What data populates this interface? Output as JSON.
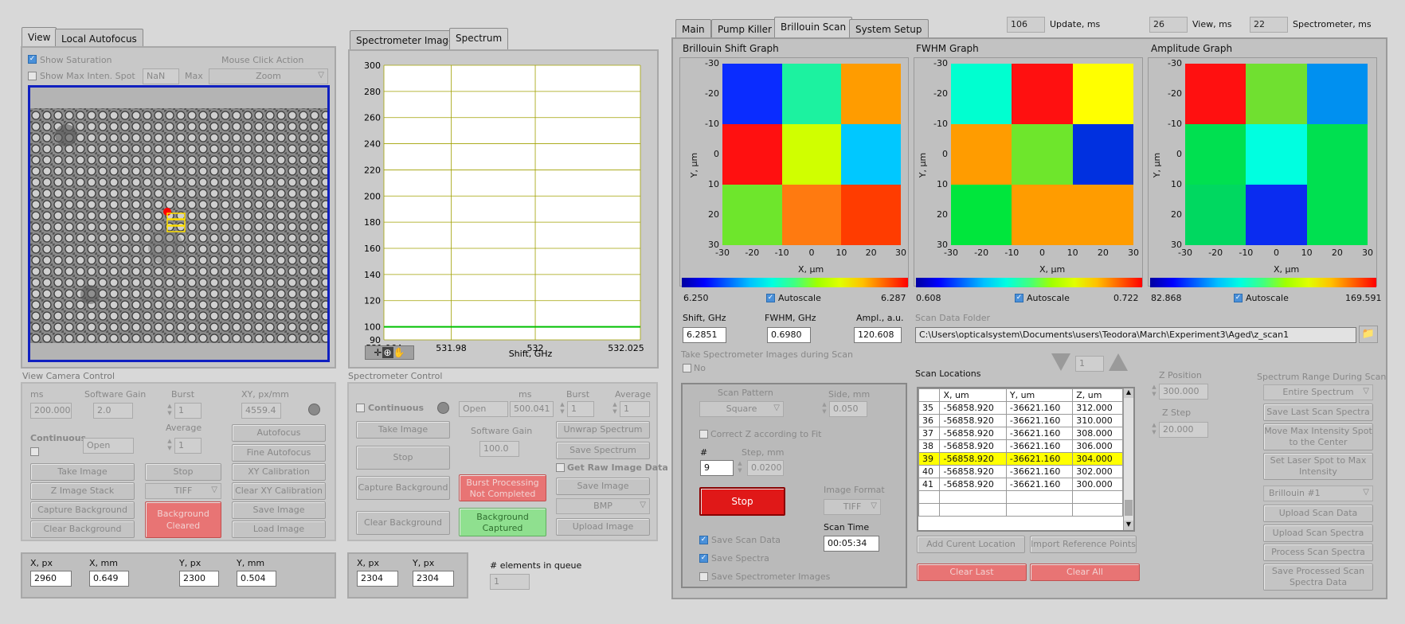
{
  "left": {
    "tabs": [
      "View",
      "Local Autofocus"
    ],
    "show_saturation": "Show Saturation",
    "show_max": "Show Max Inten. Spot",
    "max_value": "NaN",
    "max_label": "Max",
    "mouse_click_action": "Mouse Click Action",
    "zoom": "Zoom",
    "camera_control": "View Camera Control",
    "ms_label": "ms",
    "ms_value": "200.000",
    "gain_label": "Software Gain",
    "gain_value": "2.0",
    "burst_label": "Burst",
    "burst_value": "1",
    "xy_label": "XY, px/mm",
    "xy_value": "4559.4",
    "continuous": "Continuous",
    "open": "Open",
    "average_label": "Average",
    "average_value": "1",
    "buttons": {
      "autofocus": "Autofocus",
      "fine_autofocus": "Fine Autofocus",
      "take_image": "Take Image",
      "stop": "Stop",
      "xy_calibration": "XY Calibration",
      "z_stack": "Z Image Stack",
      "tiff": "TIFF",
      "clear_xy": "Clear XY Calibration",
      "capture_bg": "Capture Background",
      "bg_cleared": "Background Cleared",
      "save_image": "Save Image",
      "clear_bg": "Clear Background",
      "load_image": "Load Image"
    },
    "coords": {
      "xpx_label": "X, px",
      "xpx": "2960",
      "xmm_label": "X, mm",
      "xmm": "0.649",
      "ypx_label": "Y, px",
      "ypx": "2300",
      "ymm_label": "Y, mm",
      "ymm": "0.504"
    }
  },
  "spectro": {
    "tabs": [
      "Spectrometer Image",
      "Spectrum"
    ],
    "chart_data": {
      "type": "line",
      "x_ticks": [
        "531.964",
        "531.98",
        "532",
        "532.025"
      ],
      "y_ticks": [
        90,
        100,
        120,
        140,
        160,
        180,
        200,
        220,
        240,
        260,
        280,
        300
      ],
      "ylim": [
        90,
        300
      ],
      "xlim": [
        531.964,
        532.025
      ],
      "xlabel": "Shift, GHz",
      "series": [
        {
          "x": [
            531.964,
            532.025
          ],
          "y": [
            100,
            100
          ],
          "color": "#00c000"
        }
      ]
    },
    "control": "Spectrometer Control",
    "continuous": "Continuous",
    "ms_label": "ms",
    "open": "Open",
    "ms_value": "500.041",
    "burst_label": "Burst",
    "burst_value": "1",
    "average_label": "Average",
    "average_value": "1",
    "gain_label": "Software Gain",
    "gain_value": "100.0",
    "get_raw": "Get Raw Image Data",
    "buttons": {
      "take_image": "Take Image",
      "unwrap": "Unwrap Spectrum",
      "stop": "Stop",
      "save_spectrum": "Save Spectrum",
      "capture_bg": "Capture Background",
      "burst_processing": "Burst Processing Not Completed",
      "save_image": "Save Image",
      "clear_bg": "Clear Background",
      "bg_captured": "Background Captured",
      "bmp": "BMP",
      "upload_image": "Upload Image"
    },
    "coords": {
      "xpx_label": "X, px",
      "xpx": "2304",
      "ypx_label": "Y, px",
      "ypx": "2304"
    },
    "queue_label": "# elements in queue",
    "queue_value": "1"
  },
  "right": {
    "tabs": [
      "Main",
      "Pump Killer",
      "Brillouin Scan",
      "System Setup"
    ],
    "update_value": "106",
    "update_label": "Update, ms",
    "view_value": "26",
    "view_label": "View, ms",
    "spec_value": "22",
    "spec_label": "Spectrometer, ms",
    "graphs": [
      {
        "title": "Brillouin Shift Graph",
        "cells": [
          "#0a2cff",
          "#1cf2a0",
          "#ff9c00",
          "#ff1010",
          "#d0ff00",
          "#00c8ff",
          "#6ee62c",
          "#ff7a10",
          "#ff3c00"
        ],
        "min": "6.250",
        "max": "6.287"
      },
      {
        "title": "FWHM Graph",
        "cells": [
          "#00ffd0",
          "#ff1010",
          "#ffff00",
          "#ff9c00",
          "#6ee62c",
          "#0030e0",
          "#00e63c",
          "#ff9c00",
          "#ff9c00"
        ],
        "min": "0.608",
        "max": "0.722"
      },
      {
        "title": "Amplitude Graph",
        "cells": [
          "#ff1010",
          "#70e030",
          "#0090f0",
          "#00e050",
          "#00ffe0",
          "#00e050",
          "#00d860",
          "#0a2cf0",
          "#00e050"
        ],
        "min": "82.868",
        "max": "169.591"
      }
    ],
    "x_ticks": [
      "-30",
      "-20",
      "-10",
      "0",
      "10",
      "20",
      "30"
    ],
    "y_ticks": [
      "-30",
      "-20",
      "-10",
      "0",
      "10",
      "20",
      "30"
    ],
    "xlabel": "X, µm",
    "ylabel": "Y, µm",
    "autoscale": "Autoscale",
    "shift_label": "Shift, GHz",
    "shift_value": "6.2851",
    "fwhm_label": "FWHM, GHz",
    "fwhm_value": "0.6980",
    "ampl_label": "Ampl., a.u.",
    "ampl_value": "120.608",
    "folder_label": "Scan Data Folder",
    "folder_value": "C:\\Users\\opticalsystem\\Documents\\users\\Teodora\\March\\Experiment3\\Aged\\z_scan1",
    "take_spectro": "Take Spectrometer Images during Scan",
    "no": "No",
    "scan_pattern_label": "Scan Pattern",
    "scan_pattern": "Square",
    "side_label": "Side, mm",
    "side_value": "0.050",
    "correct_z": "Correct Z according to Fit",
    "num_label": "#",
    "num_value": "9",
    "step_label": "Step, mm",
    "step_value": "0.0200",
    "stop": "Stop",
    "image_format_label": "Image Format",
    "image_format": "TIFF",
    "scan_time_label": "Scan Time",
    "scan_time": "00:05:34",
    "save_scan_data": "Save Scan Data",
    "save_spectra": "Save Spectra",
    "save_spectro_images": "Save Spectrometer Images",
    "locations_label": "Scan Locations",
    "loc_headers": [
      "",
      "X, um",
      "Y, um",
      "Z, um"
    ],
    "loc_rows": [
      [
        "35",
        "-56858.920",
        "-36621.160",
        "312.000"
      ],
      [
        "36",
        "-56858.920",
        "-36621.160",
        "310.000"
      ],
      [
        "37",
        "-56858.920",
        "-36621.160",
        "308.000"
      ],
      [
        "38",
        "-56858.920",
        "-36621.160",
        "306.000"
      ],
      [
        "39",
        "-56858.920",
        "-36621.160",
        "304.000"
      ],
      [
        "40",
        "-56858.920",
        "-36621.160",
        "302.000"
      ],
      [
        "41",
        "-56858.920",
        "-36621.160",
        "300.000"
      ]
    ],
    "highlight_row": 4,
    "nav_value": "1",
    "add_location": "Add Curent Location",
    "import_ref": "Import Reference Points",
    "clear_last": "Clear Last",
    "clear_all": "Clear All",
    "zpos_label": "Z Position",
    "zpos_value": "300.000",
    "zstep_label": "Z Step",
    "zstep_value": "20.000",
    "spec_range_label": "Spectrum Range During Scan",
    "spec_range": "Entire Spectrum",
    "buttons": {
      "save_last": "Save Last Scan Spectra",
      "move_max": "Move Max Intensity Spot to the Center",
      "set_laser": "Set Laser Spot to Max Intensity",
      "brillouin": "Brillouin #1",
      "upload_scan": "Upload Scan Data",
      "upload_spectra": "Upload Scan Spectra",
      "process": "Process Scan Spectra",
      "save_processed": "Save Processed Scan Spectra Data"
    }
  }
}
